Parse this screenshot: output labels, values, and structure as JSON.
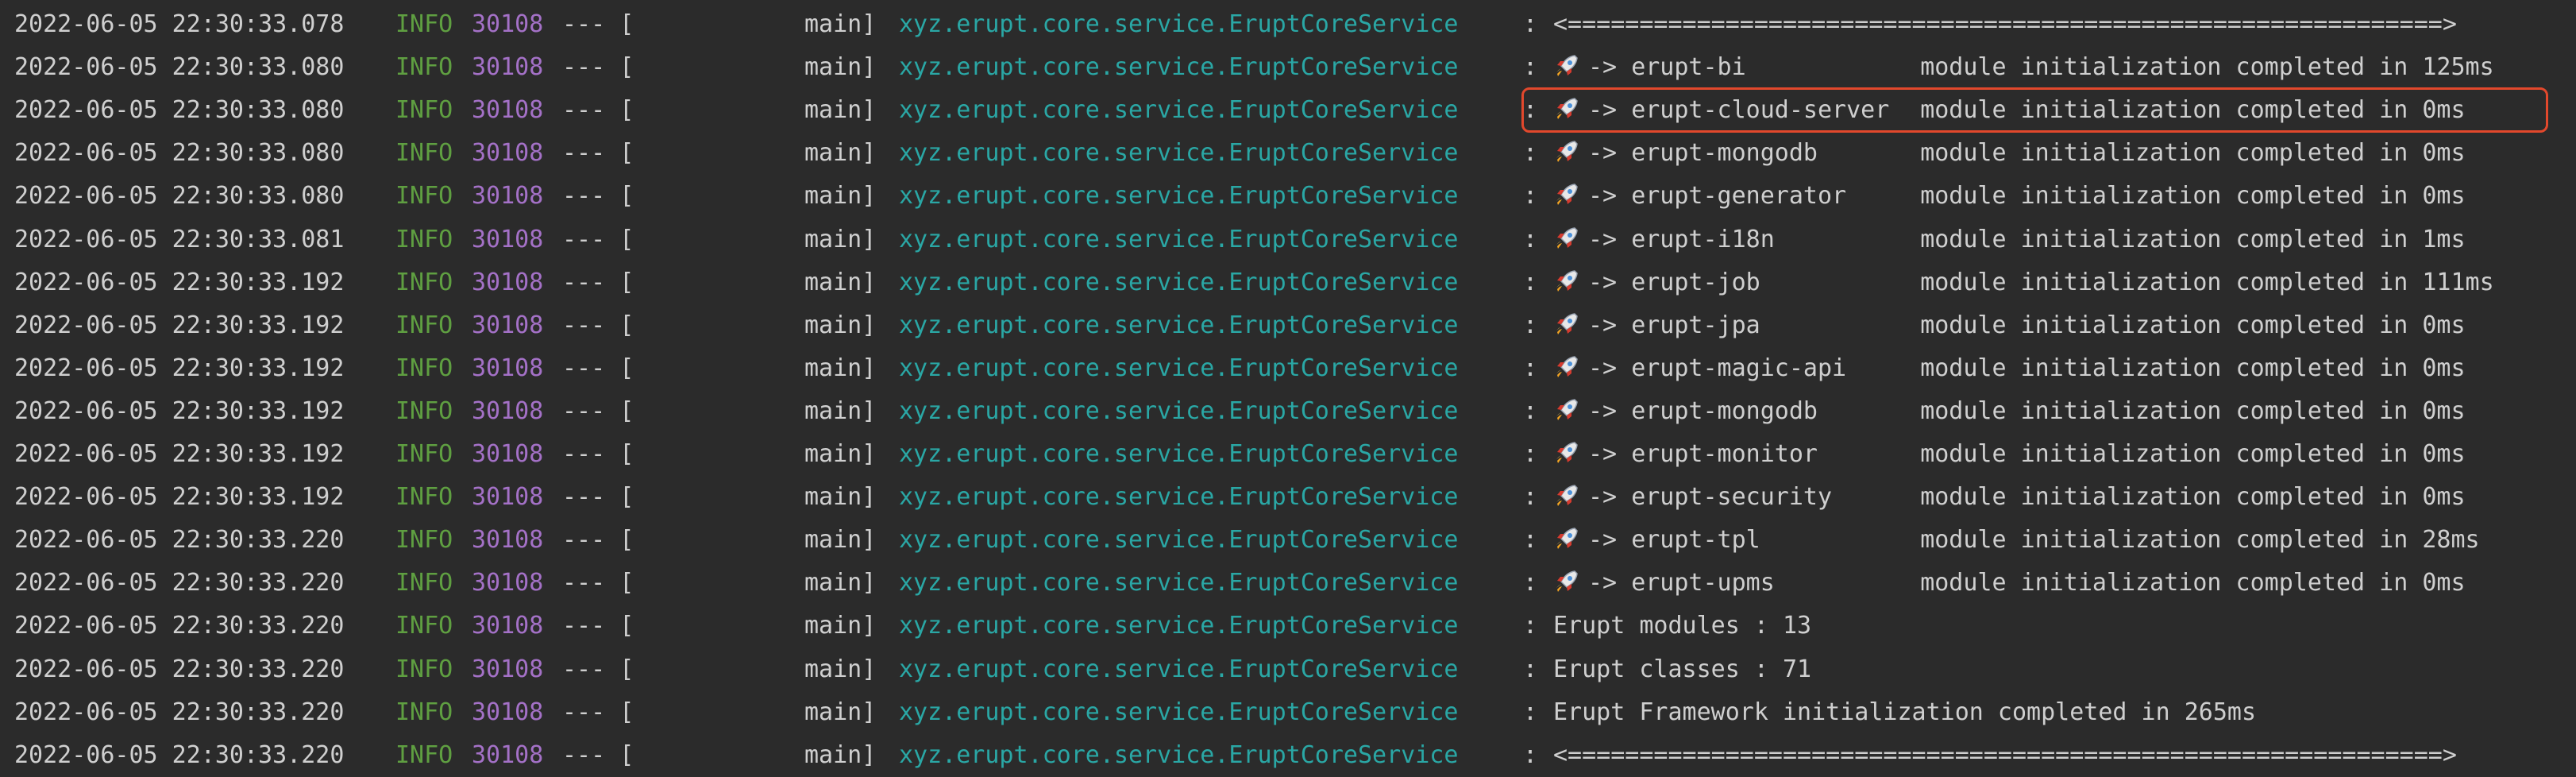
{
  "highlight_color": "#e2482c",
  "colors": {
    "background": "#2b2b2b",
    "text": "#cfcfcf",
    "level": "#5f9f41",
    "pid": "#a471c7",
    "logger": "#2aa7a5"
  },
  "rows": [
    {
      "ts": "2022-06-05 22:30:33.078",
      "level": "INFO",
      "pid": "30108",
      "sep": "--- [",
      "thread": "main]",
      "logger": "xyz.erupt.core.service.EruptCoreService",
      "colon": ":",
      "message": "<=============================================================>"
    },
    {
      "ts": "2022-06-05 22:30:33.080",
      "level": "INFO",
      "pid": "30108",
      "sep": "--- [",
      "thread": "main]",
      "logger": "xyz.erupt.core.service.EruptCoreService",
      "colon": ":",
      "icon": "rocket-icon",
      "arrow": "->",
      "module": "erupt-bi",
      "status": "module initialization completed in 125ms"
    },
    {
      "ts": "2022-06-05 22:30:33.080",
      "level": "INFO",
      "pid": "30108",
      "sep": "--- [",
      "thread": "main]",
      "logger": "xyz.erupt.core.service.EruptCoreService",
      "colon": ":",
      "icon": "rocket-icon",
      "arrow": "->",
      "module": "erupt-cloud-server",
      "status": "module initialization completed in 0ms"
    },
    {
      "ts": "2022-06-05 22:30:33.080",
      "level": "INFO",
      "pid": "30108",
      "sep": "--- [",
      "thread": "main]",
      "logger": "xyz.erupt.core.service.EruptCoreService",
      "colon": ":",
      "icon": "rocket-icon",
      "arrow": "->",
      "module": "erupt-mongodb",
      "status": "module initialization completed in 0ms"
    },
    {
      "ts": "2022-06-05 22:30:33.080",
      "level": "INFO",
      "pid": "30108",
      "sep": "--- [",
      "thread": "main]",
      "logger": "xyz.erupt.core.service.EruptCoreService",
      "colon": ":",
      "icon": "rocket-icon",
      "arrow": "->",
      "module": "erupt-generator",
      "status": "module initialization completed in 0ms"
    },
    {
      "ts": "2022-06-05 22:30:33.081",
      "level": "INFO",
      "pid": "30108",
      "sep": "--- [",
      "thread": "main]",
      "logger": "xyz.erupt.core.service.EruptCoreService",
      "colon": ":",
      "icon": "rocket-icon",
      "arrow": "->",
      "module": "erupt-i18n",
      "status": "module initialization completed in 1ms"
    },
    {
      "ts": "2022-06-05 22:30:33.192",
      "level": "INFO",
      "pid": "30108",
      "sep": "--- [",
      "thread": "main]",
      "logger": "xyz.erupt.core.service.EruptCoreService",
      "colon": ":",
      "icon": "rocket-icon",
      "arrow": "->",
      "module": "erupt-job",
      "status": "module initialization completed in 111ms"
    },
    {
      "ts": "2022-06-05 22:30:33.192",
      "level": "INFO",
      "pid": "30108",
      "sep": "--- [",
      "thread": "main]",
      "logger": "xyz.erupt.core.service.EruptCoreService",
      "colon": ":",
      "icon": "rocket-icon",
      "arrow": "->",
      "module": "erupt-jpa",
      "status": "module initialization completed in 0ms"
    },
    {
      "ts": "2022-06-05 22:30:33.192",
      "level": "INFO",
      "pid": "30108",
      "sep": "--- [",
      "thread": "main]",
      "logger": "xyz.erupt.core.service.EruptCoreService",
      "colon": ":",
      "icon": "rocket-icon",
      "arrow": "->",
      "module": "erupt-magic-api",
      "status": "module initialization completed in 0ms"
    },
    {
      "ts": "2022-06-05 22:30:33.192",
      "level": "INFO",
      "pid": "30108",
      "sep": "--- [",
      "thread": "main]",
      "logger": "xyz.erupt.core.service.EruptCoreService",
      "colon": ":",
      "icon": "rocket-icon",
      "arrow": "->",
      "module": "erupt-mongodb",
      "status": "module initialization completed in 0ms"
    },
    {
      "ts": "2022-06-05 22:30:33.192",
      "level": "INFO",
      "pid": "30108",
      "sep": "--- [",
      "thread": "main]",
      "logger": "xyz.erupt.core.service.EruptCoreService",
      "colon": ":",
      "icon": "rocket-icon",
      "arrow": "->",
      "module": "erupt-monitor",
      "status": "module initialization completed in 0ms"
    },
    {
      "ts": "2022-06-05 22:30:33.192",
      "level": "INFO",
      "pid": "30108",
      "sep": "--- [",
      "thread": "main]",
      "logger": "xyz.erupt.core.service.EruptCoreService",
      "colon": ":",
      "icon": "rocket-icon",
      "arrow": "->",
      "module": "erupt-security",
      "status": "module initialization completed in 0ms"
    },
    {
      "ts": "2022-06-05 22:30:33.220",
      "level": "INFO",
      "pid": "30108",
      "sep": "--- [",
      "thread": "main]",
      "logger": "xyz.erupt.core.service.EruptCoreService",
      "colon": ":",
      "icon": "rocket-icon",
      "arrow": "->",
      "module": "erupt-tpl",
      "status": "module initialization completed in 28ms"
    },
    {
      "ts": "2022-06-05 22:30:33.220",
      "level": "INFO",
      "pid": "30108",
      "sep": "--- [",
      "thread": "main]",
      "logger": "xyz.erupt.core.service.EruptCoreService",
      "colon": ":",
      "icon": "rocket-icon",
      "arrow": "->",
      "module": "erupt-upms",
      "status": "module initialization completed in 0ms"
    },
    {
      "ts": "2022-06-05 22:30:33.220",
      "level": "INFO",
      "pid": "30108",
      "sep": "--- [",
      "thread": "main]",
      "logger": "xyz.erupt.core.service.EruptCoreService",
      "colon": ":",
      "message": "Erupt modules : 13"
    },
    {
      "ts": "2022-06-05 22:30:33.220",
      "level": "INFO",
      "pid": "30108",
      "sep": "--- [",
      "thread": "main]",
      "logger": "xyz.erupt.core.service.EruptCoreService",
      "colon": ":",
      "message": "Erupt classes : 71"
    },
    {
      "ts": "2022-06-05 22:30:33.220",
      "level": "INFO",
      "pid": "30108",
      "sep": "--- [",
      "thread": "main]",
      "logger": "xyz.erupt.core.service.EruptCoreService",
      "colon": ":",
      "message": "Erupt Framework initialization completed in 265ms"
    },
    {
      "ts": "2022-06-05 22:30:33.220",
      "level": "INFO",
      "pid": "30108",
      "sep": "--- [",
      "thread": "main]",
      "logger": "xyz.erupt.core.service.EruptCoreService",
      "colon": ":",
      "message": "<=============================================================>"
    }
  ]
}
